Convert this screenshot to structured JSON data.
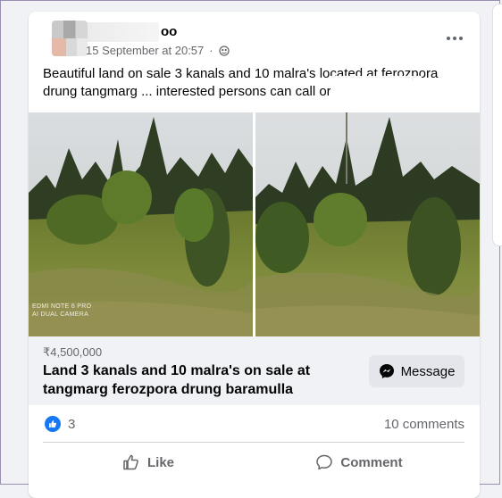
{
  "post": {
    "author_visible": "oo",
    "timestamp": "15 September at 20:57",
    "audience_icon": "globe-icon",
    "text": "Beautiful land on sale 3 kanals and 10 malra's located at ferozpora drung tangmarg ... interested persons can call or",
    "photo_watermark": "EDMI NOTE 6 PRO\nAI DUAL CAMERA"
  },
  "listing": {
    "price": "₹4,500,000",
    "title": "Land 3 kanals and 10 malra's on sale at tangmarg ferozpora drung baramulla",
    "message_label": "Message"
  },
  "stats": {
    "like_count": "3",
    "comments": "10 comments"
  },
  "actions": {
    "like_label": "Like",
    "comment_label": "Comment"
  },
  "colors": {
    "accent": "#1877f2",
    "listing_bg": "#f0f2f5",
    "secondary_text": "#65676b"
  }
}
